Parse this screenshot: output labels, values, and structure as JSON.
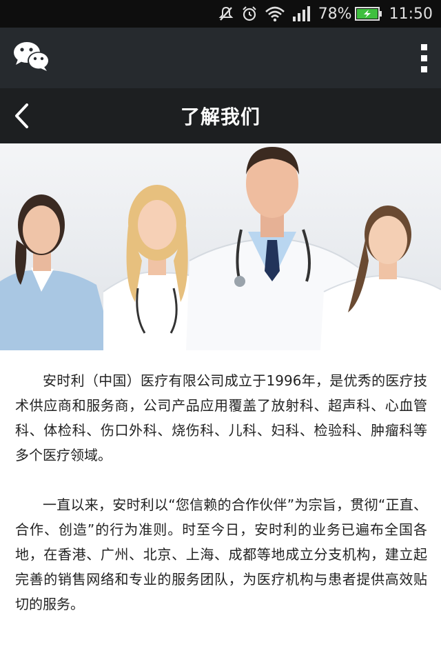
{
  "status": {
    "battery": "78%",
    "time": "11:50"
  },
  "header": {
    "title": "了解我们"
  },
  "content": {
    "paragraphs": [
      "安时利（中国）医疗有限公司成立于1996年，是优秀的医疗技术供应商和服务商，公司产品应用覆盖了放射科、超声科、心血管科、体检科、伤口外科、烧伤科、儿科、妇科、检验科、肿瘤科等多个医疗领域。",
      "一直以来，安时利以“您信赖的合作伙伴”为宗旨，贯彻“正直、合作、创造”的行为准则。时至今日，安时利的业务已遍布全国各地，在香港、广州、北京、上海、成都等地成立分支机构，建立起完善的销售网络和专业的服务团队，为医疗机构与患者提供高效贴切的服务。"
    ]
  },
  "icons": {
    "status": [
      "silent-icon",
      "alarm-icon",
      "wifi-icon",
      "signal-icon",
      "battery-charging-icon"
    ],
    "app_bar": [
      "wechat-logo-icon",
      "more-menu-icon"
    ],
    "title_bar": [
      "back-arrow-icon"
    ]
  },
  "colors": {
    "status_bar": "#0e0e0e",
    "app_bar": "#262a2e",
    "title_bar": "#1d1f21",
    "battery_fill": "#3fbf3f",
    "text": "#222222"
  }
}
